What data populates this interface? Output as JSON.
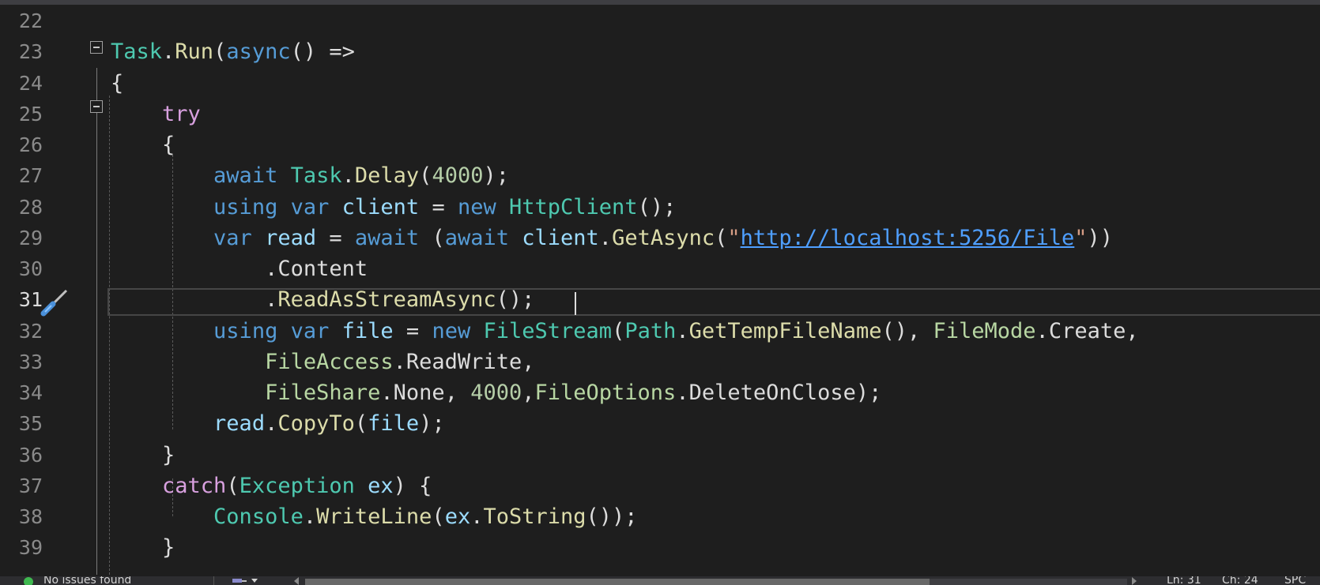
{
  "editor": {
    "current_line": 31,
    "lines": [
      {
        "num": "22",
        "tokens": []
      },
      {
        "num": "23",
        "tokens": [
          {
            "t": "Task",
            "c": "type"
          },
          {
            "t": ".",
            "c": "plain"
          },
          {
            "t": "Run",
            "c": "method"
          },
          {
            "t": "(",
            "c": "plain"
          },
          {
            "t": "async",
            "c": "kw"
          },
          {
            "t": "() =>",
            "c": "plain"
          }
        ]
      },
      {
        "num": "24",
        "tokens": [
          {
            "t": "{",
            "c": "plain"
          }
        ]
      },
      {
        "num": "25",
        "tokens": [
          {
            "t": "    ",
            "c": "plain"
          },
          {
            "t": "try",
            "c": "ctrl"
          }
        ]
      },
      {
        "num": "26",
        "tokens": [
          {
            "t": "    {",
            "c": "plain"
          }
        ]
      },
      {
        "num": "27",
        "tokens": [
          {
            "t": "        ",
            "c": "plain"
          },
          {
            "t": "await",
            "c": "kw"
          },
          {
            "t": " ",
            "c": "plain"
          },
          {
            "t": "Task",
            "c": "type"
          },
          {
            "t": ".",
            "c": "plain"
          },
          {
            "t": "Delay",
            "c": "method"
          },
          {
            "t": "(",
            "c": "plain"
          },
          {
            "t": "4000",
            "c": "num"
          },
          {
            "t": ");",
            "c": "plain"
          }
        ]
      },
      {
        "num": "28",
        "tokens": [
          {
            "t": "        ",
            "c": "plain"
          },
          {
            "t": "using",
            "c": "kw"
          },
          {
            "t": " ",
            "c": "plain"
          },
          {
            "t": "var",
            "c": "kw"
          },
          {
            "t": " ",
            "c": "plain"
          },
          {
            "t": "client",
            "c": "var"
          },
          {
            "t": " = ",
            "c": "plain"
          },
          {
            "t": "new",
            "c": "kw"
          },
          {
            "t": " ",
            "c": "plain"
          },
          {
            "t": "HttpClient",
            "c": "type"
          },
          {
            "t": "();",
            "c": "plain"
          }
        ]
      },
      {
        "num": "29",
        "tokens": [
          {
            "t": "        ",
            "c": "plain"
          },
          {
            "t": "var",
            "c": "kw"
          },
          {
            "t": " ",
            "c": "plain"
          },
          {
            "t": "read",
            "c": "var"
          },
          {
            "t": " = ",
            "c": "plain"
          },
          {
            "t": "await",
            "c": "kw"
          },
          {
            "t": " (",
            "c": "plain"
          },
          {
            "t": "await",
            "c": "kw"
          },
          {
            "t": " ",
            "c": "plain"
          },
          {
            "t": "client",
            "c": "var"
          },
          {
            "t": ".",
            "c": "plain"
          },
          {
            "t": "GetAsync",
            "c": "method"
          },
          {
            "t": "(",
            "c": "plain"
          },
          {
            "t": "\"",
            "c": "str"
          },
          {
            "t": "http://localhost:5256/File",
            "c": "link"
          },
          {
            "t": "\"",
            "c": "str"
          },
          {
            "t": "))",
            "c": "plain"
          }
        ]
      },
      {
        "num": "30",
        "tokens": [
          {
            "t": "            .Content",
            "c": "plain"
          }
        ]
      },
      {
        "num": "31",
        "tokens": [
          {
            "t": "            .",
            "c": "plain"
          },
          {
            "t": "ReadAsStreamAsync",
            "c": "method"
          },
          {
            "t": "();",
            "c": "plain"
          }
        ]
      },
      {
        "num": "32",
        "tokens": [
          {
            "t": "        ",
            "c": "plain"
          },
          {
            "t": "using",
            "c": "kw"
          },
          {
            "t": " ",
            "c": "plain"
          },
          {
            "t": "var",
            "c": "kw"
          },
          {
            "t": " ",
            "c": "plain"
          },
          {
            "t": "file",
            "c": "var"
          },
          {
            "t": " = ",
            "c": "plain"
          },
          {
            "t": "new",
            "c": "kw"
          },
          {
            "t": " ",
            "c": "plain"
          },
          {
            "t": "FileStream",
            "c": "type"
          },
          {
            "t": "(",
            "c": "plain"
          },
          {
            "t": "Path",
            "c": "type"
          },
          {
            "t": ".",
            "c": "plain"
          },
          {
            "t": "GetTempFileName",
            "c": "method"
          },
          {
            "t": "(), ",
            "c": "plain"
          },
          {
            "t": "FileMode",
            "c": "enum"
          },
          {
            "t": ".",
            "c": "plain"
          },
          {
            "t": "Create",
            "c": "plain"
          },
          {
            "t": ",",
            "c": "plain"
          }
        ]
      },
      {
        "num": "33",
        "tokens": [
          {
            "t": "            ",
            "c": "plain"
          },
          {
            "t": "FileAccess",
            "c": "enum"
          },
          {
            "t": ".",
            "c": "plain"
          },
          {
            "t": "ReadWrite",
            "c": "plain"
          },
          {
            "t": ",",
            "c": "plain"
          }
        ]
      },
      {
        "num": "34",
        "tokens": [
          {
            "t": "            ",
            "c": "plain"
          },
          {
            "t": "FileShare",
            "c": "enum"
          },
          {
            "t": ".",
            "c": "plain"
          },
          {
            "t": "None",
            "c": "plain"
          },
          {
            "t": ", ",
            "c": "plain"
          },
          {
            "t": "4000",
            "c": "num"
          },
          {
            "t": ",",
            "c": "plain"
          },
          {
            "t": "FileOptions",
            "c": "enum"
          },
          {
            "t": ".",
            "c": "plain"
          },
          {
            "t": "DeleteOnClose",
            "c": "plain"
          },
          {
            "t": ");",
            "c": "plain"
          }
        ]
      },
      {
        "num": "35",
        "tokens": [
          {
            "t": "        ",
            "c": "plain"
          },
          {
            "t": "read",
            "c": "var"
          },
          {
            "t": ".",
            "c": "plain"
          },
          {
            "t": "CopyTo",
            "c": "method"
          },
          {
            "t": "(",
            "c": "plain"
          },
          {
            "t": "file",
            "c": "var"
          },
          {
            "t": ");",
            "c": "plain"
          }
        ]
      },
      {
        "num": "36",
        "tokens": [
          {
            "t": "    }",
            "c": "plain"
          }
        ]
      },
      {
        "num": "37",
        "tokens": [
          {
            "t": "    ",
            "c": "plain"
          },
          {
            "t": "catch",
            "c": "ctrl"
          },
          {
            "t": "(",
            "c": "plain"
          },
          {
            "t": "Exception",
            "c": "type"
          },
          {
            "t": " ",
            "c": "plain"
          },
          {
            "t": "ex",
            "c": "var"
          },
          {
            "t": ") {",
            "c": "plain"
          }
        ]
      },
      {
        "num": "38",
        "tokens": [
          {
            "t": "        ",
            "c": "plain"
          },
          {
            "t": "Console",
            "c": "type"
          },
          {
            "t": ".",
            "c": "plain"
          },
          {
            "t": "WriteLine",
            "c": "method"
          },
          {
            "t": "(",
            "c": "plain"
          },
          {
            "t": "ex",
            "c": "var"
          },
          {
            "t": ".",
            "c": "plain"
          },
          {
            "t": "ToString",
            "c": "method"
          },
          {
            "t": "());",
            "c": "plain"
          }
        ]
      },
      {
        "num": "39",
        "tokens": [
          {
            "t": "    }",
            "c": "plain"
          }
        ]
      }
    ]
  },
  "status": {
    "issues": "No issues found",
    "ln": "Ln: 31",
    "ch": "Ch: 24",
    "enc": "SPC"
  },
  "colors": {
    "background": "#1e1e1e",
    "type": "#4ec9b0",
    "method": "#dcdcaa",
    "keyword": "#569cd6",
    "control": "#d8a0df",
    "variable": "#9cdcfe",
    "number": "#b5cea8",
    "string": "#d69d85",
    "link": "#4f9fff"
  }
}
